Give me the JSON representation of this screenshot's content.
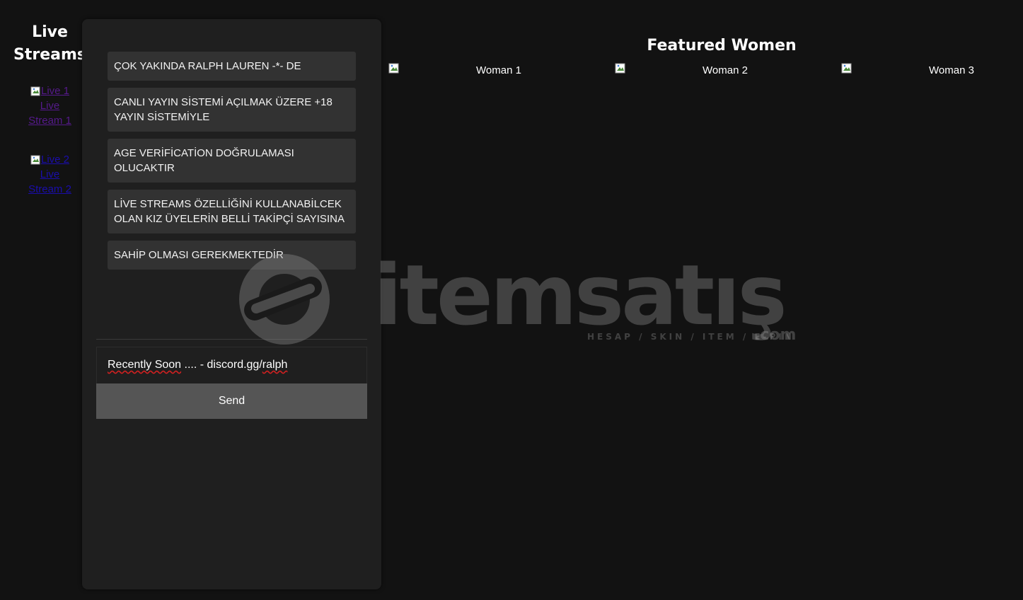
{
  "live_streams": {
    "title": "Live Streams",
    "items": [
      {
        "alt": "Live 1",
        "label": "Live Stream 1",
        "state": "visited"
      },
      {
        "alt": "Live 2",
        "label": "Live Stream 2",
        "state": "unvisited"
      }
    ]
  },
  "chat": {
    "messages": [
      "ÇOK YAKINDA RALPH LAUREN -*- DE",
      "CANLI YAYIN SİSTEMİ AÇILMAK ÜZERE +18 YAYIN SİSTEMİYLE",
      "AGE VERİFİCATİON DOĞRULAMASI OLUCAKTIR",
      "LİVE STREAMS ÖZELLİĞİNİ KULLANABİLCEK OLAN KIZ ÜYELERİN BELLİ TAKİPÇİ SAYISINA",
      "SAHİP OLMASI GEREKMEKTEDİR"
    ],
    "input_value_part1": "Recently Soon",
    "input_value_part2": " .... - discord.gg/",
    "input_value_part3": "ralph",
    "send_label": "Send"
  },
  "featured": {
    "title": "Featured Women",
    "women": [
      {
        "alt": "Woman 1"
      },
      {
        "alt": "Woman 2"
      },
      {
        "alt": "Woman 3"
      }
    ]
  },
  "watermark": {
    "brand": "itemsatış",
    "tagline": "HESAP / SKIN / ITEM / E-PIN",
    "suffix": ".com"
  },
  "colors": {
    "page_bg": "#121212",
    "panel_bg": "#1f1f1f",
    "message_bg": "#323232",
    "button_bg": "#555555",
    "link_visited": "#551a8b",
    "link_unvisited": "#1a0dab"
  }
}
